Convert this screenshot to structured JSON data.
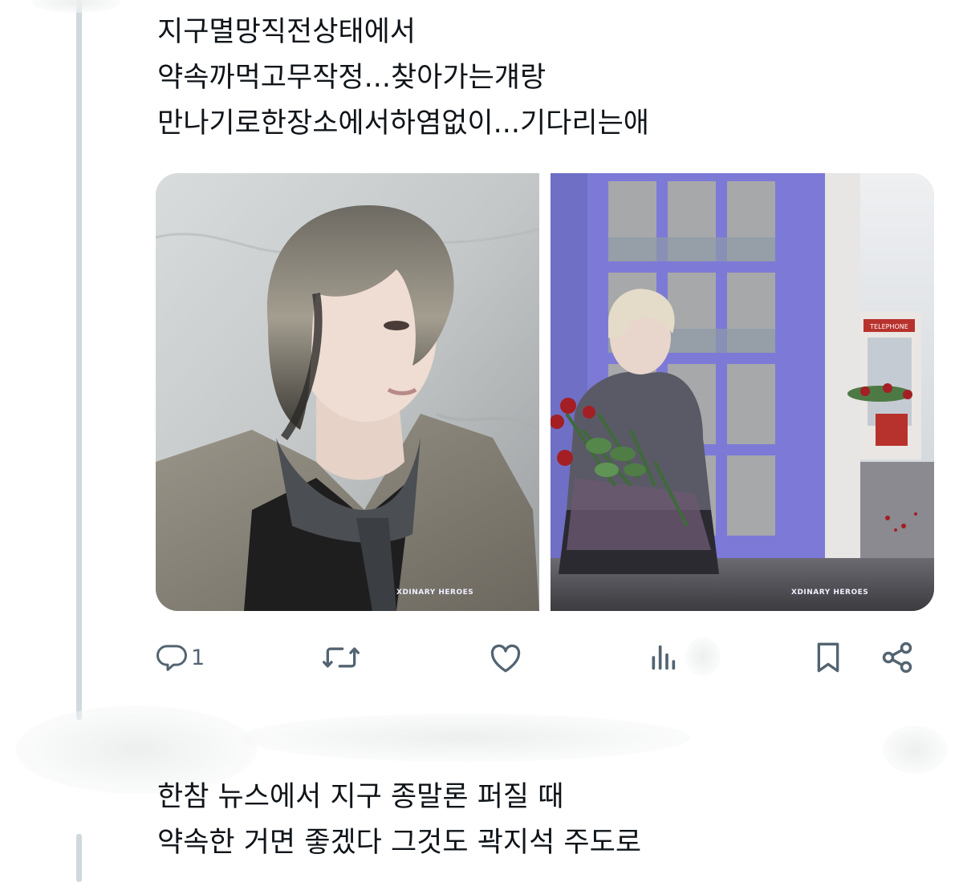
{
  "tweet": {
    "lines": [
      "지구멸망직전상태에서",
      "약속까먹고무작정...찾아가는걔랑",
      "만나기로한장소에서하염없이...기다리는애"
    ],
    "media": {
      "left_watermark": "XDINARY HEROES",
      "right_watermark": "XDINARY HEROES",
      "booth_sign": "TELEPHONE"
    },
    "actions": {
      "reply_count": "1",
      "icons": [
        "reply-icon",
        "retweet-icon",
        "like-icon",
        "views-icon",
        "bookmark-icon",
        "share-icon"
      ]
    }
  },
  "reply": {
    "lines": [
      "한참 뉴스에서 지구 종말론 퍼질 때",
      "약속한 거면 좋겠다 그것도 곽지석 주도로"
    ]
  },
  "colors": {
    "text": "#0f1419",
    "icon": "#536471",
    "thread_line": "#cfd9de"
  }
}
